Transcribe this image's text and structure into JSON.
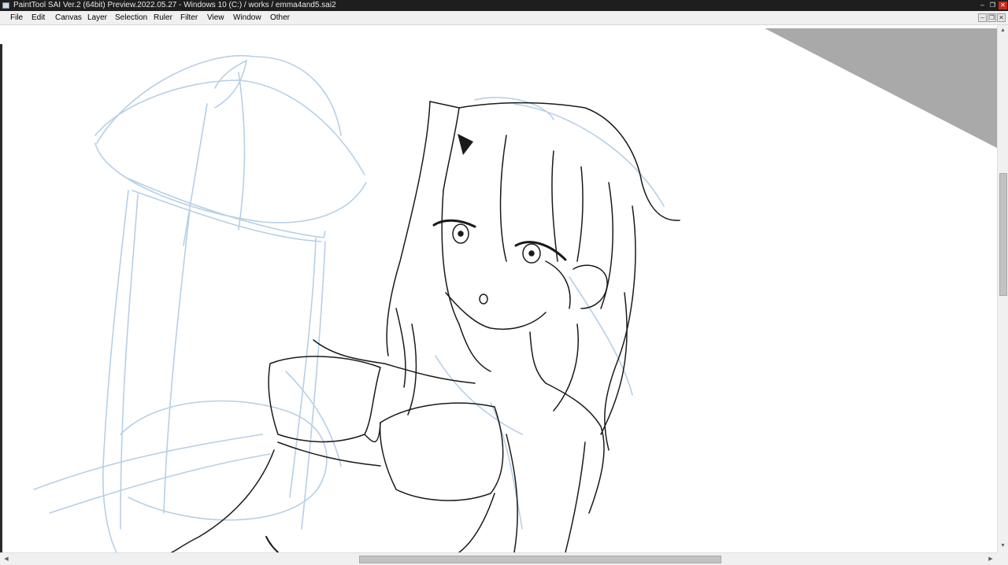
{
  "window": {
    "title": "PaintTool SAI Ver.2 (64bit) Preview.2022.05.27 - Windows 10 (C:) / works / emma4and5.sai2",
    "app_icon": "sai-app-icon",
    "controls": {
      "minimize": "‒",
      "restore": "❐",
      "close": "✕"
    }
  },
  "menubar": {
    "items": [
      {
        "label": "File",
        "name": "file"
      },
      {
        "label": "Edit",
        "name": "edit"
      },
      {
        "label": "Canvas",
        "name": "canvas"
      },
      {
        "label": "Layer",
        "name": "layer"
      },
      {
        "label": "Selection",
        "name": "selection"
      },
      {
        "label": "Ruler",
        "name": "ruler"
      },
      {
        "label": "Filter",
        "name": "filter"
      },
      {
        "label": "View",
        "name": "view"
      },
      {
        "label": "Window",
        "name": "window"
      },
      {
        "label": "Other",
        "name": "other"
      }
    ],
    "mdi_controls": {
      "minimize": "‒",
      "restore": "❐",
      "close": "✕"
    }
  },
  "canvas": {
    "document": "emma4and5.sai2",
    "sketch_color": "#b7cfe6",
    "ink_color": "#1a1a1a",
    "offcanvas_color": "#a9a9a9"
  },
  "scrollbars": {
    "vertical": {
      "up": "▲",
      "down": "▼"
    },
    "horizontal": {
      "left": "◀",
      "right": "▶"
    }
  }
}
